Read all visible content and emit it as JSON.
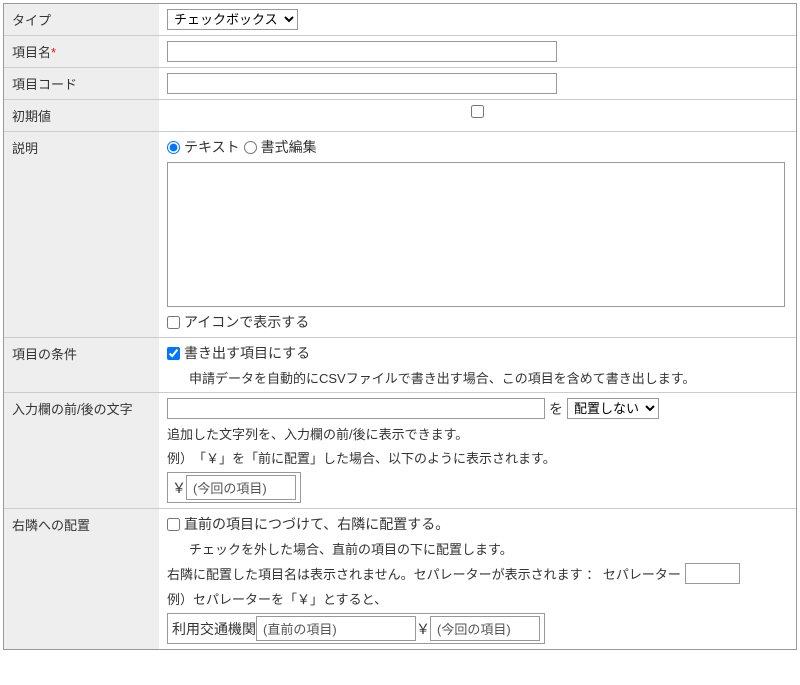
{
  "labels": {
    "type": "タイプ",
    "itemName": "項目名",
    "itemCode": "項目コード",
    "initValue": "初期値",
    "description": "説明",
    "conditions": "項目の条件",
    "beforeAfter": "入力欄の前/後の文字",
    "rightPlacement": "右隣への配置"
  },
  "type": {
    "selected": "チェックボックス"
  },
  "desc": {
    "radioText": "テキスト",
    "radioFormat": "書式編集",
    "showIcon": "アイコンで表示する"
  },
  "cond": {
    "export": "書き出す項目にする",
    "exportHint": "申請データを自動的にCSVファイルで書き出す場合、この項目を含めて書き出します。"
  },
  "ba": {
    "wo": "を",
    "placeSuffix": "配置しない",
    "hint1": "追加した文字列を、入力欄の前/後に表示できます。",
    "hint2": "例）　「￥」を「前に配置」した場合、以下のように表示されます。",
    "yen": "￥",
    "thisItem": "(今回の項目)"
  },
  "right": {
    "checkLabel": "直前の項目につづけて、右隣に配置する。",
    "hint1": "チェックを外した場合、直前の項目の下に配置します。",
    "hint2a": "右隣に配置した項目名は表示されません。セパレーターが表示されます ： セパレーター",
    "hint3": "例）セパレーターを「￥」とすると、",
    "transport": "利用交通機関",
    "prevItem": "(直前の項目)",
    "yen": "￥",
    "thisItem": "(今回の項目)"
  }
}
